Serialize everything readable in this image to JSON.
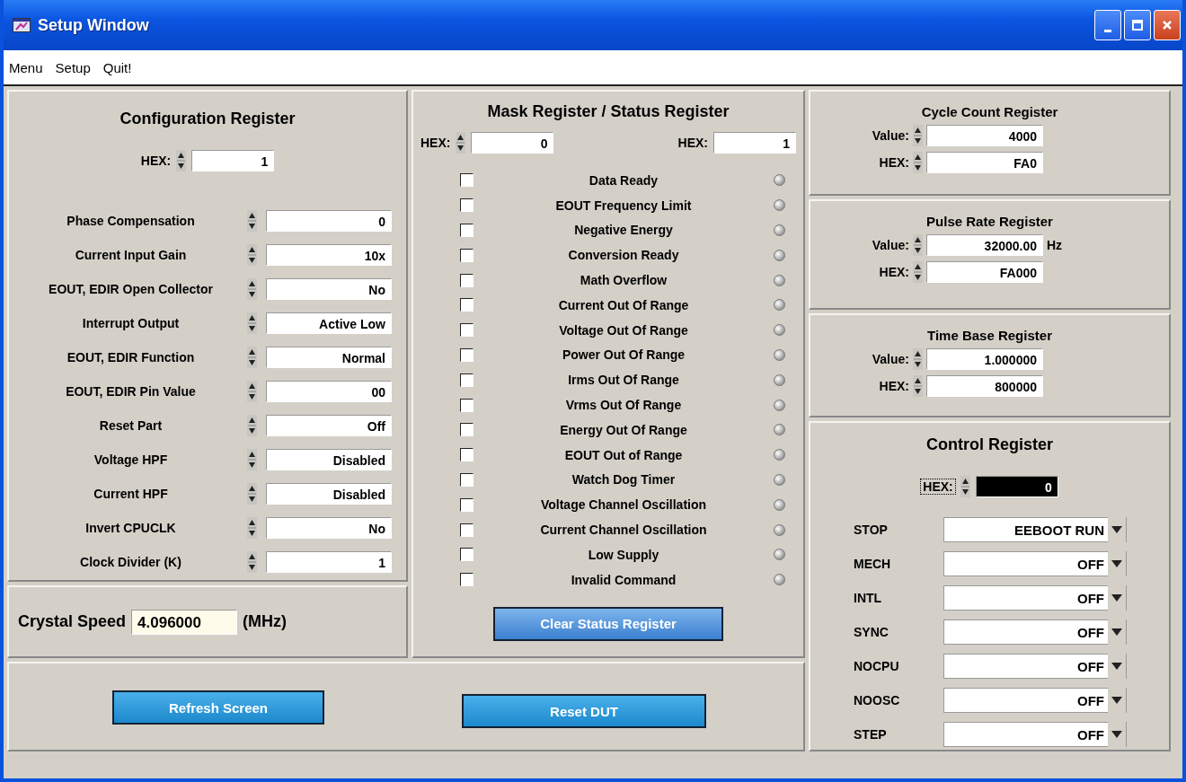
{
  "window": {
    "title": "Setup Window"
  },
  "menu": [
    "Menu",
    "Setup",
    "Quit!"
  ],
  "configuration": {
    "title": "Configuration Register",
    "hex_label": "HEX:",
    "hex": "1",
    "fields": [
      {
        "label": "Phase Compensation",
        "value": "0"
      },
      {
        "label": "Current Input Gain",
        "value": "10x"
      },
      {
        "label": "EOUT, EDIR Open Collector",
        "value": "No"
      },
      {
        "label": "Interrupt Output",
        "value": "Active Low"
      },
      {
        "label": "EOUT, EDIR Function",
        "value": "Normal"
      },
      {
        "label": "EOUT, EDIR Pin Value",
        "value": "00"
      },
      {
        "label": "Reset Part",
        "value": "Off"
      },
      {
        "label": "Voltage HPF",
        "value": "Disabled"
      },
      {
        "label": "Current HPF",
        "value": "Disabled"
      },
      {
        "label": "Invert CPUCLK",
        "value": "No"
      },
      {
        "label": "Clock Divider (K)",
        "value": "1"
      }
    ]
  },
  "crystal": {
    "label": "Crystal Speed",
    "value": "4.096000",
    "unit": "(MHz)"
  },
  "mask_status": {
    "title": "Mask Register / Status Register",
    "mask_hex_label": "HEX:",
    "mask_hex": "0",
    "status_hex_label": "HEX:",
    "status_hex": "1",
    "flags": [
      {
        "label": "Data Ready",
        "checked": false,
        "lit": false
      },
      {
        "label": "EOUT Frequency Limit",
        "checked": false,
        "lit": false
      },
      {
        "label": "Negative Energy",
        "checked": false,
        "lit": false
      },
      {
        "label": "Conversion Ready",
        "checked": false,
        "lit": false
      },
      {
        "label": "Math Overflow",
        "checked": false,
        "lit": false
      },
      {
        "label": "Current Out Of Range",
        "checked": false,
        "lit": false
      },
      {
        "label": "Voltage Out Of Range",
        "checked": false,
        "lit": false
      },
      {
        "label": "Power Out Of Range",
        "checked": false,
        "lit": false
      },
      {
        "label": "Irms Out Of Range",
        "checked": false,
        "lit": false
      },
      {
        "label": "Vrms Out Of Range",
        "checked": false,
        "lit": false
      },
      {
        "label": "Energy Out Of Range",
        "checked": false,
        "lit": false
      },
      {
        "label": "EOUT Out of Range",
        "checked": false,
        "lit": false
      },
      {
        "label": "Watch Dog Timer",
        "checked": false,
        "lit": false
      },
      {
        "label": "Voltage Channel Oscillation",
        "checked": false,
        "lit": false
      },
      {
        "label": "Current Channel Oscillation",
        "checked": false,
        "lit": false
      },
      {
        "label": "Low Supply",
        "checked": false,
        "lit": false
      },
      {
        "label": "Invalid Command",
        "checked": false,
        "lit": false
      }
    ],
    "button": "Clear Status Register"
  },
  "registers": [
    {
      "title": "Cycle Count Register",
      "rows": [
        {
          "label": "Value:",
          "value": "4000"
        },
        {
          "label": "HEX:",
          "value": "FA0"
        }
      ]
    },
    {
      "title": "Pulse Rate Register",
      "rows": [
        {
          "label": "Value:",
          "value": "32000.00",
          "unit": "Hz"
        },
        {
          "label": "HEX:",
          "value": "FA000"
        }
      ]
    },
    {
      "title": "Time Base Register",
      "rows": [
        {
          "label": "Value:",
          "value": "1.000000"
        },
        {
          "label": "HEX:",
          "value": "800000"
        }
      ]
    }
  ],
  "control": {
    "title": "Control Register",
    "hex_label": "HEX:",
    "hex": "0",
    "hex_focused": true,
    "selects": [
      {
        "label": "STOP",
        "value": "EEBOOT RUN"
      },
      {
        "label": "MECH",
        "value": "OFF"
      },
      {
        "label": "INTL",
        "value": "OFF"
      },
      {
        "label": "SYNC",
        "value": "OFF"
      },
      {
        "label": "NOCPU",
        "value": "OFF"
      },
      {
        "label": "NOOSC",
        "value": "OFF"
      },
      {
        "label": "STEP",
        "value": "OFF"
      }
    ]
  },
  "buttons": [
    "Refresh Screen",
    "Reset DUT"
  ]
}
